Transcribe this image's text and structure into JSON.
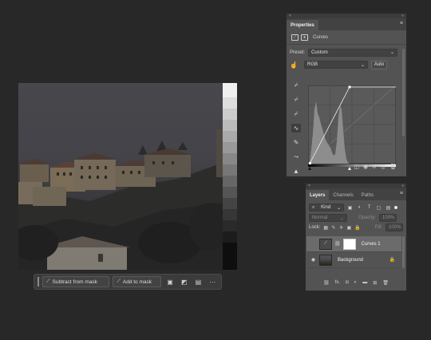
{
  "mask_toolbar": {
    "subtract_label": "Subtract from mask",
    "add_label": "Add to mask",
    "more_label": "···"
  },
  "properties": {
    "title": "Properties",
    "adjustment_name": "Curves",
    "preset_label": "Preset:",
    "preset_value": "Custom",
    "channel_value": "RGB",
    "auto_label": "Auto"
  },
  "layers": {
    "tabs": [
      {
        "label": "Layers"
      },
      {
        "label": "Channels"
      },
      {
        "label": "Paths"
      }
    ],
    "kind_label": "Kind",
    "blend_mode": "Normal",
    "opacity_label": "Opacity:",
    "opacity_value": "100%",
    "lock_label": "Lock:",
    "fill_label": "Fill:",
    "fill_value": "100%",
    "items": [
      {
        "name": "Curves 1",
        "type": "adjustment",
        "selected": true
      },
      {
        "name": "Background",
        "type": "pixel",
        "locked": true
      }
    ],
    "footer_fx": "fx."
  },
  "colors": {
    "app_bg": "#282828",
    "panel_bg": "#535353",
    "selected_layer": "#6b6b6b"
  }
}
